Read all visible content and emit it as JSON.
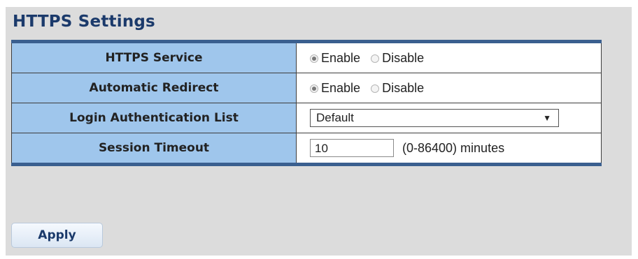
{
  "page": {
    "title": "HTTPS Settings"
  },
  "https_service": {
    "label": "HTTPS Service",
    "enable_label": "Enable",
    "disable_label": "Disable",
    "selected": "Enable"
  },
  "auto_redirect": {
    "label": "Automatic Redirect",
    "enable_label": "Enable",
    "disable_label": "Disable",
    "selected": "Enable"
  },
  "login_auth": {
    "label": "Login Authentication List",
    "selected": "Default"
  },
  "session_timeout": {
    "label": "Session Timeout",
    "value": "10",
    "hint": "(0-86400) minutes"
  },
  "actions": {
    "apply_label": "Apply"
  },
  "colors": {
    "header_blue": "#9fc6ec",
    "border_dark": "#3a5f8f",
    "title_text": "#1b3a6b"
  },
  "icons": {
    "dropdown": "chevron-down-icon"
  }
}
